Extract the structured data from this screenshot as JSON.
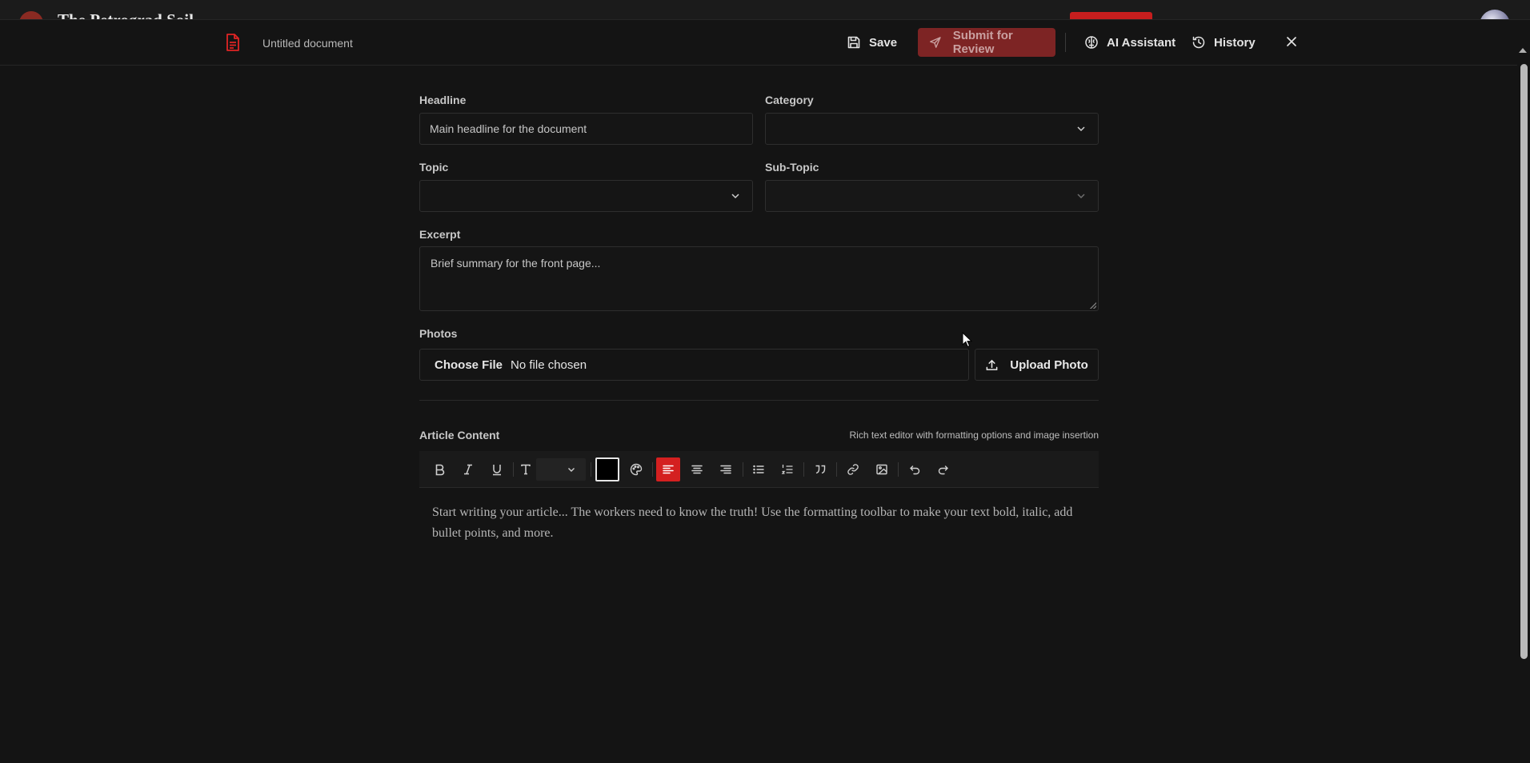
{
  "background_app": {
    "title": "The Petrograd Soil"
  },
  "header": {
    "document_title": "Untitled document",
    "save_label": "Save",
    "submit_label": "Submit for Review",
    "ai_label": "AI Assistant",
    "history_label": "History"
  },
  "form": {
    "headline": {
      "label": "Headline",
      "placeholder": "Main headline for the document"
    },
    "category": {
      "label": "Category",
      "value": ""
    },
    "topic": {
      "label": "Topic",
      "value": ""
    },
    "subtopic": {
      "label": "Sub-Topic",
      "value": ""
    },
    "excerpt": {
      "label": "Excerpt",
      "placeholder": "Brief summary for the front page..."
    },
    "photos": {
      "label": "Photos",
      "choose_label": "Choose File",
      "status": "No file chosen",
      "upload_label": "Upload Photo"
    }
  },
  "editor": {
    "label": "Article Content",
    "hint": "Rich text editor with formatting options and image insertion",
    "placeholder": "Start writing your article... The workers need to know the truth! Use the formatting toolbar to make your text bold, italic, add bullet points, and more.",
    "active_alignment": "align-left",
    "text_color": "#000000"
  },
  "colors": {
    "accent": "#d42020",
    "submit_bg": "#7d2424",
    "background": "#141414"
  }
}
